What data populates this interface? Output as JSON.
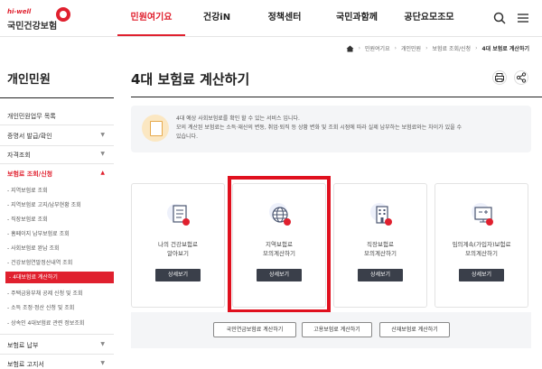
{
  "header": {
    "logo_sub": "hi-well",
    "logo_name": "국민건강보험",
    "nav": [
      {
        "label": "민원여기요",
        "active": true
      },
      {
        "label": "건강iN",
        "active": false
      },
      {
        "label": "정책센터",
        "active": false
      },
      {
        "label": "국민과함께",
        "active": false
      },
      {
        "label": "공단요모조모",
        "active": false
      }
    ],
    "icons": {
      "search": "search-icon",
      "menu": "menu-icon"
    },
    "accent_color": "#e0202e"
  },
  "breadcrumb": {
    "home_icon": "home-icon",
    "items": [
      "민원여기요",
      "개인민원",
      "보험료 조회/신청",
      "4대 보험료 계산하기"
    ]
  },
  "sidebar": {
    "title": "개인민원",
    "items": [
      {
        "label": "개인민원업무 목록",
        "arrow": ""
      },
      {
        "label": "증명서 발급/확인",
        "arrow": "▼"
      },
      {
        "label": "자격조회",
        "arrow": "▼"
      },
      {
        "label": "보험료 조회/신청",
        "arrow": "▲"
      },
      {
        "label": "보험료 납부",
        "arrow": "▼"
      },
      {
        "label": "보험료 고지서",
        "arrow": "▼"
      }
    ],
    "sub_items": [
      "- 지역보험료 조회",
      "- 지역보험료 고지/납부현황 조회",
      "- 직장보험료 조회",
      "- 홈페이지 납부보험료 조회",
      "- 사회보험료 완납 조회",
      "- 건강보험연말정산내역 조회",
      "- 4대보험료 계산하기",
      "- 주택금융부채 공제 신청 및 조회",
      "- 소득 조정·정산 신청 및 조회",
      "- 상속인 4대보험료 관련 정보조회"
    ]
  },
  "main": {
    "title": "4대 보험료 계산하기",
    "print_icon": "print-icon",
    "share_icon": "share-icon",
    "info_lines": [
      "4대 예상 사회보험료를 확인 할 수 있는 서비스 입니다.",
      "모의 계산된 보험료는 소득·재산의 변동, 취업·퇴직 등 상황 변화 및 조회 시점에 따라 실제 납부하는 보험료와는 차이가 있을 수",
      "있습니다."
    ],
    "cards": [
      {
        "line1": "나의 건강보험료",
        "line2": "알아보기",
        "button": "상세보기",
        "icon": "document-icon"
      },
      {
        "line1": "지역보험료",
        "line2": "모의계산하기",
        "button": "상세보기",
        "icon": "globe-icon"
      },
      {
        "line1": "직장보험료",
        "line2": "모의계산하기",
        "button": "상세보기",
        "icon": "building-icon"
      },
      {
        "line1": "임의계속(가입자)보험료",
        "line2": "모의계산하기",
        "button": "상세보기",
        "icon": "calculator-icon"
      }
    ],
    "bottom_buttons": [
      "국민연금보험료 계산하기",
      "고용보험료 계산하기",
      "산재보험료 계산하기"
    ]
  }
}
